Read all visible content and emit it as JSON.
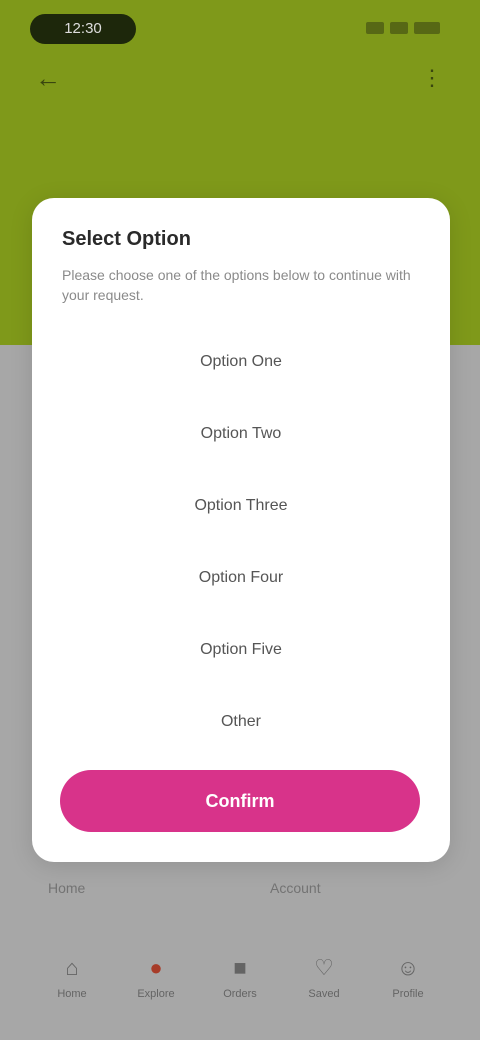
{
  "status_bar": {
    "time": "12:30"
  },
  "background": {
    "left_text": "Home",
    "right_text": "Account"
  },
  "bottom_nav": [
    {
      "label": "Home"
    },
    {
      "label": "Explore"
    },
    {
      "label": "Orders"
    },
    {
      "label": "Saved"
    },
    {
      "label": "Profile"
    }
  ],
  "dialog": {
    "title": "Select Option",
    "description": "Please choose one of the options below to continue with your request.",
    "options": [
      {
        "label": "Option One"
      },
      {
        "label": "Option Two"
      },
      {
        "label": "Option Three"
      },
      {
        "label": "Option Four"
      },
      {
        "label": "Option Five"
      },
      {
        "label": "Other"
      }
    ],
    "confirm_label": "Confirm"
  },
  "colors": {
    "header": "#86a21c",
    "accent": "#d8338a"
  },
  "icons": {
    "back": "back-arrow-icon",
    "menu": "menu-icon"
  }
}
